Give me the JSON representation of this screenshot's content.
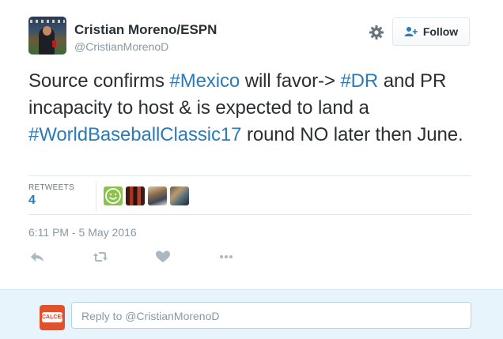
{
  "user": {
    "name": "Cristian Moreno/ESPN",
    "handle": "@CristianMorenoD"
  },
  "header": {
    "follow_label": "Follow"
  },
  "tweet": {
    "segments": [
      {
        "text": "Source confirms ",
        "hashtag": false
      },
      {
        "text": "#Mexico",
        "hashtag": true
      },
      {
        "text": " will favor-> ",
        "hashtag": false
      },
      {
        "text": "#DR",
        "hashtag": true
      },
      {
        "text": " and PR incapacity to host & is expected to land a ",
        "hashtag": false
      },
      {
        "text": "#WorldBaseballClassic17",
        "hashtag": true
      },
      {
        "text": " round NO later then June.",
        "hashtag": false
      }
    ]
  },
  "stats": {
    "retweets_label": "RETWEETS",
    "retweets_count": "4"
  },
  "retweeter_avatars": [
    "green-smiley-avatar",
    "red-room-avatar",
    "people-avatar",
    "group-avatar"
  ],
  "timestamp": "6:11 PM - 5 May 2016",
  "actions": [
    "reply-icon",
    "retweet-icon",
    "like-icon",
    "more-icon"
  ],
  "reply": {
    "avatar_text": "CALCE!",
    "placeholder": "Reply to @CristianMorenoD"
  },
  "colors": {
    "link": "#2b7bb9",
    "text": "#292f33",
    "muted": "#8899a6",
    "reply_bg": "#e8f4fb"
  }
}
